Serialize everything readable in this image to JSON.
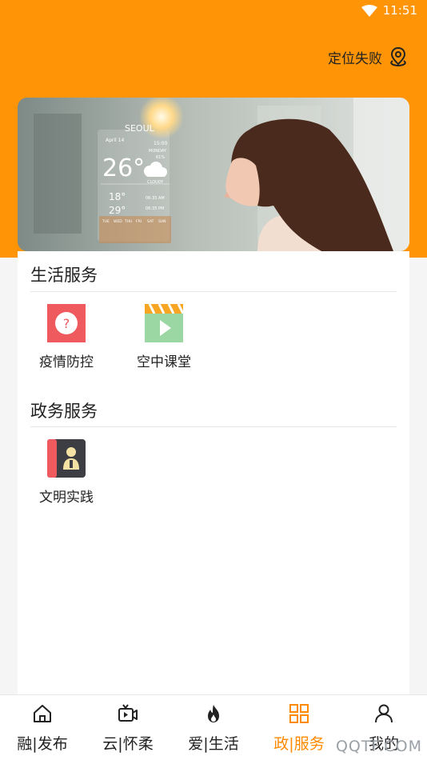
{
  "status_bar": {
    "time": "11:51",
    "wifi_icon": "wifi-icon"
  },
  "header": {
    "location_text": "定位失败",
    "location_icon": "location-pin-icon"
  },
  "banner": {
    "weather": {
      "city": "SEOUL",
      "date": "April 14",
      "time": "15:00",
      "day": "MONDAY",
      "humidity": "61%",
      "temperature": "26°",
      "condition": "CLOUDY",
      "low": "18°",
      "high": "29°",
      "sunrise": "06:35 AM",
      "sunset": "06:35 PM",
      "week_days": [
        "TUE",
        "WED",
        "THU",
        "FRI",
        "SAT",
        "SUN"
      ]
    }
  },
  "sections": [
    {
      "title": "生活服务",
      "items": [
        {
          "label": "疫情防控",
          "icon": "question-icon"
        },
        {
          "label": "空中课堂",
          "icon": "video-clapper-icon"
        }
      ]
    },
    {
      "title": "政务服务",
      "items": [
        {
          "label": "文明实践",
          "icon": "contact-book-icon"
        }
      ]
    }
  ],
  "bottom_nav": {
    "active_index": 3,
    "active_color": "#ff8a00",
    "items": [
      {
        "label": "融|发布",
        "icon": "home-icon"
      },
      {
        "label": "云|怀柔",
        "icon": "video-icon"
      },
      {
        "label": "爱|生活",
        "icon": "flame-icon"
      },
      {
        "label": "政|服务",
        "icon": "grid-icon"
      },
      {
        "label": "我的",
        "icon": "user-icon"
      }
    ]
  },
  "watermark": "QQTF.COM",
  "colors": {
    "accent": "#ff9506",
    "card": "#ffffff",
    "background": "#f5f5f5"
  }
}
